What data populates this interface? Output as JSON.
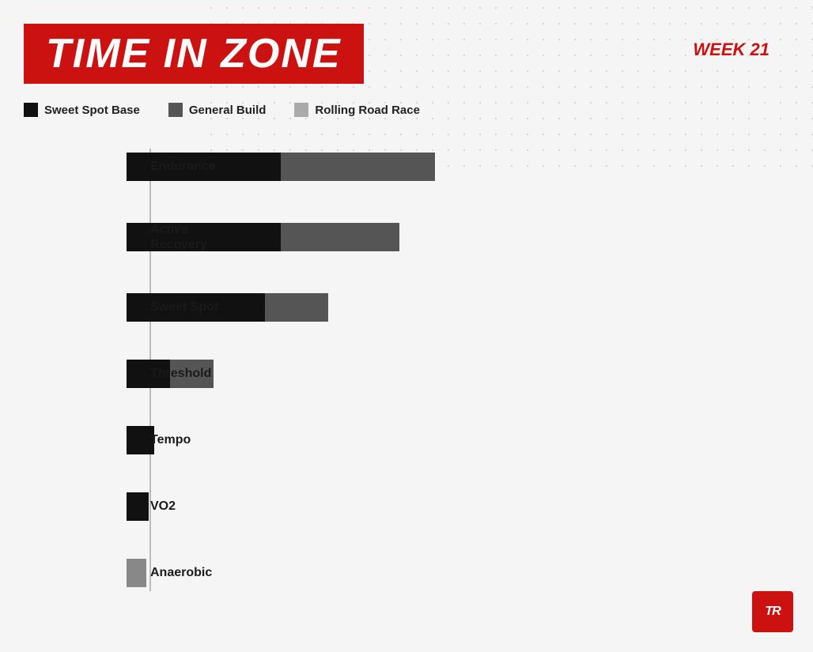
{
  "header": {
    "title": "TIME IN ZONE",
    "week": "WEEK 21"
  },
  "legend": {
    "items": [
      {
        "label": "Sweet Spot Base",
        "color": "#111111"
      },
      {
        "label": "General Build",
        "color": "#555555"
      },
      {
        "label": "Rolling Road Race",
        "color": "#aaaaaa"
      }
    ]
  },
  "chart": {
    "axis_color": "#bbbbbb",
    "rows": [
      {
        "label": "Endurance",
        "segments": [
          {
            "value": 195,
            "color": "#111111"
          },
          {
            "value": 195,
            "color": "#555555"
          }
        ]
      },
      {
        "label": "Active\nRecovery",
        "segments": [
          {
            "value": 195,
            "color": "#111111"
          },
          {
            "value": 150,
            "color": "#555555"
          }
        ]
      },
      {
        "label": "Sweet Spot",
        "segments": [
          {
            "value": 175,
            "color": "#111111"
          },
          {
            "value": 80,
            "color": "#555555"
          }
        ]
      },
      {
        "label": "Threshold",
        "segments": [
          {
            "value": 55,
            "color": "#111111"
          },
          {
            "value": 55,
            "color": "#555555"
          }
        ]
      },
      {
        "label": "Tempo",
        "segments": [
          {
            "value": 35,
            "color": "#111111"
          }
        ]
      },
      {
        "label": "VO2",
        "segments": [
          {
            "value": 28,
            "color": "#111111"
          }
        ]
      },
      {
        "label": "Anaerobic",
        "segments": [
          {
            "value": 25,
            "color": "#888888"
          }
        ]
      }
    ]
  },
  "logo": {
    "text": "TR"
  }
}
